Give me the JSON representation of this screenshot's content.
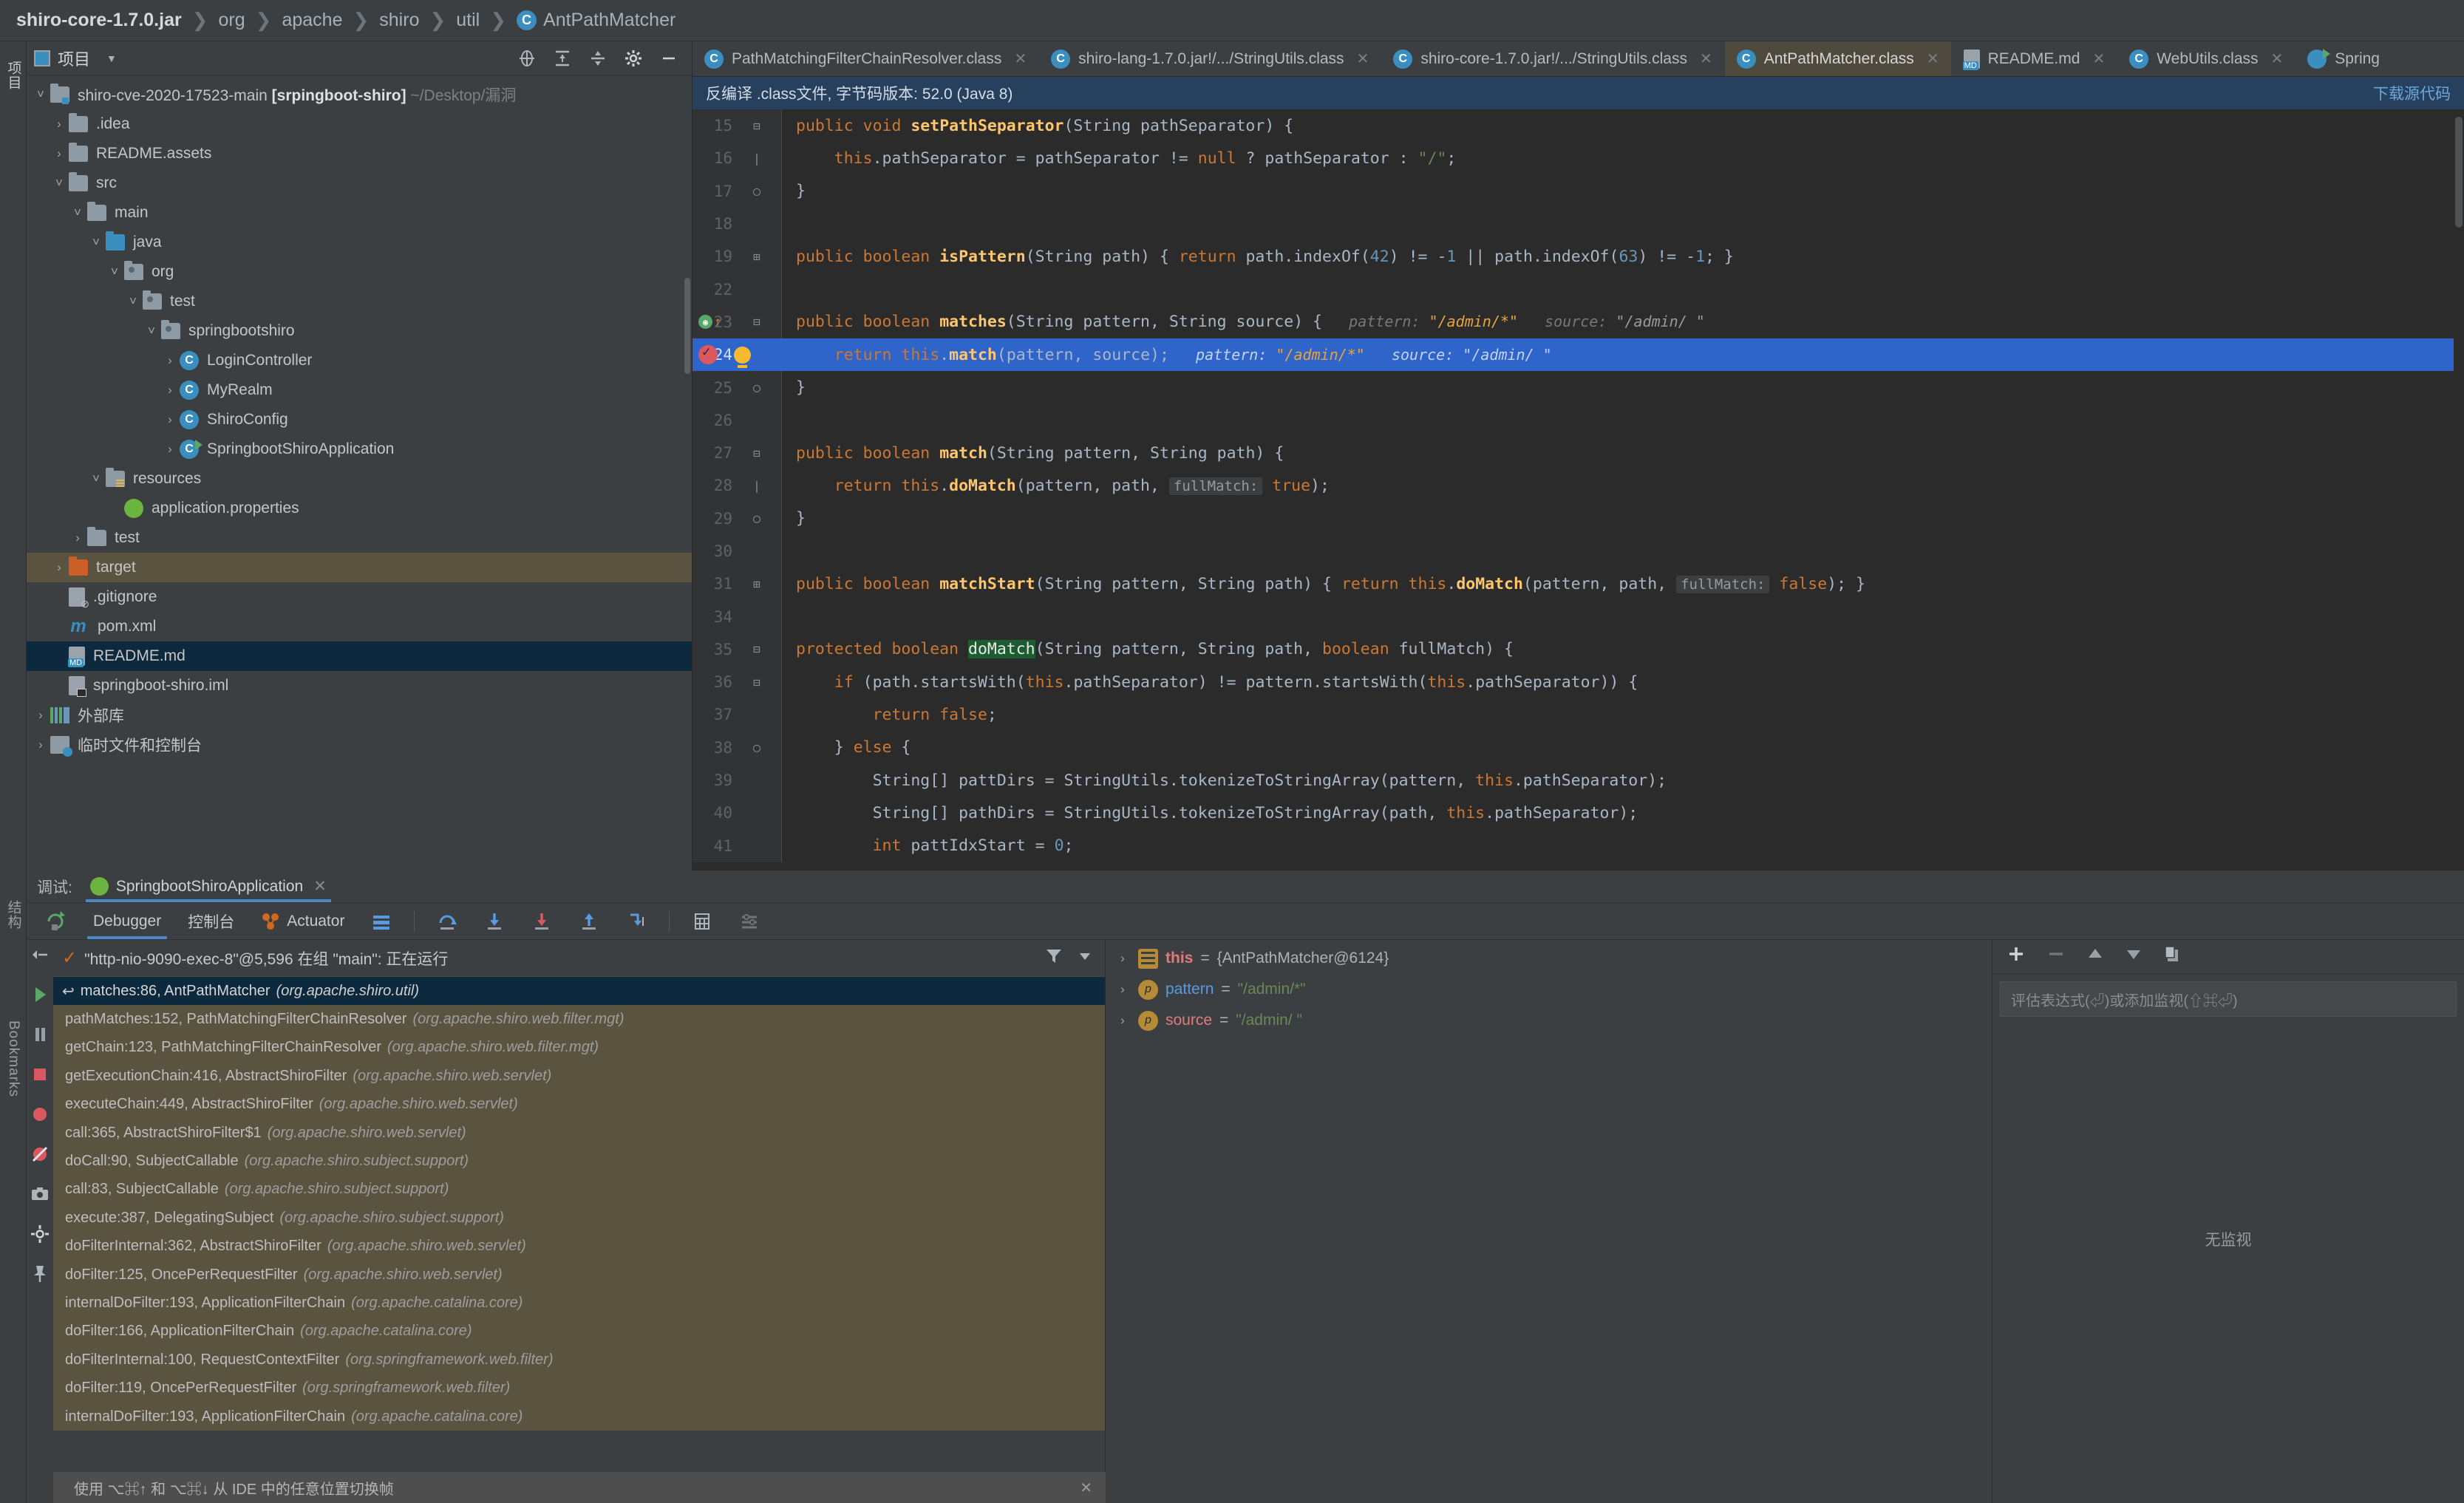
{
  "breadcrumb": {
    "items": [
      {
        "label": "shiro-core-1.7.0.jar",
        "type": "root"
      },
      {
        "label": "org",
        "type": "pkg"
      },
      {
        "label": "apache",
        "type": "pkg"
      },
      {
        "label": "shiro",
        "type": "pkg"
      },
      {
        "label": "util",
        "type": "pkg"
      },
      {
        "label": "AntPathMatcher",
        "type": "class"
      }
    ]
  },
  "left_strip": {
    "project_tab": "项目",
    "structure_tab": "结构",
    "bookmarks_tab": "Bookmarks"
  },
  "project": {
    "title": "项目",
    "tree": [
      {
        "indent": 0,
        "arrow": "v",
        "icon": "folder-module",
        "label": "shiro-cve-2020-17523-main ",
        "bold": "[srpingboot-shiro]",
        "sub": " ~/Desktop/漏洞",
        "state": "normal"
      },
      {
        "indent": 1,
        "arrow": ">",
        "icon": "folder",
        "label": ".idea",
        "state": "normal"
      },
      {
        "indent": 1,
        "arrow": ">",
        "icon": "folder",
        "label": "README.assets",
        "state": "normal"
      },
      {
        "indent": 1,
        "arrow": "v",
        "icon": "folder",
        "label": "src",
        "state": "normal"
      },
      {
        "indent": 2,
        "arrow": "v",
        "icon": "folder",
        "label": "main",
        "state": "normal"
      },
      {
        "indent": 3,
        "arrow": "v",
        "icon": "folder-source",
        "label": "java",
        "state": "normal"
      },
      {
        "indent": 4,
        "arrow": "v",
        "icon": "folder-package",
        "label": "org",
        "state": "normal"
      },
      {
        "indent": 5,
        "arrow": "v",
        "icon": "folder-package",
        "label": "test",
        "state": "normal"
      },
      {
        "indent": 6,
        "arrow": "v",
        "icon": "folder-package",
        "label": "springbootshiro",
        "state": "normal"
      },
      {
        "indent": 7,
        "arrow": ">",
        "icon": "class",
        "label": "LoginController",
        "state": "normal"
      },
      {
        "indent": 7,
        "arrow": ">",
        "icon": "class",
        "label": "MyRealm",
        "state": "normal"
      },
      {
        "indent": 7,
        "arrow": ">",
        "icon": "class",
        "label": "ShiroConfig",
        "state": "normal"
      },
      {
        "indent": 7,
        "arrow": ">",
        "icon": "class-run",
        "label": "SpringbootShiroApplication",
        "state": "normal"
      },
      {
        "indent": 3,
        "arrow": "v",
        "icon": "folder-resources",
        "label": "resources",
        "state": "normal"
      },
      {
        "indent": 4,
        "arrow": "",
        "icon": "spring",
        "label": "application.properties",
        "state": "normal"
      },
      {
        "indent": 2,
        "arrow": ">",
        "icon": "folder",
        "label": "test",
        "state": "normal"
      },
      {
        "indent": 1,
        "arrow": ">",
        "icon": "folder-target",
        "label": "target",
        "state": "target-selected"
      },
      {
        "indent": 1,
        "arrow": "",
        "icon": "file-git",
        "label": ".gitignore",
        "state": "normal"
      },
      {
        "indent": 1,
        "arrow": "",
        "icon": "maven",
        "label": "pom.xml",
        "state": "normal"
      },
      {
        "indent": 1,
        "arrow": "",
        "icon": "file-md",
        "label": "README.md",
        "state": "readme-selected"
      },
      {
        "indent": 1,
        "arrow": "",
        "icon": "file-iml",
        "label": "springboot-shiro.iml",
        "state": "normal"
      },
      {
        "indent": 0,
        "arrow": ">",
        "icon": "libraries",
        "label": "外部库",
        "state": "normal"
      },
      {
        "indent": 0,
        "arrow": ">",
        "icon": "scratches",
        "label": "临时文件和控制台",
        "state": "normal"
      }
    ]
  },
  "editor_tabs": [
    {
      "label": "PathMatchingFilterChainResolver.class",
      "icon": "class",
      "active": false
    },
    {
      "label": "shiro-lang-1.7.0.jar!/.../StringUtils.class",
      "icon": "class",
      "active": false
    },
    {
      "label": "shiro-core-1.7.0.jar!/.../StringUtils.class",
      "icon": "class",
      "active": false
    },
    {
      "label": "AntPathMatcher.class",
      "icon": "class",
      "active": true
    },
    {
      "label": "README.md",
      "icon": "markdown",
      "active": false
    },
    {
      "label": "WebUtils.class",
      "icon": "class",
      "active": false
    },
    {
      "label": "Spring",
      "icon": "spring-run",
      "active": false
    }
  ],
  "notice": {
    "text": "反编译 .class文件, 字节码版本: 52.0 (Java 8)",
    "download_label": "下载源代码"
  },
  "code": {
    "lines": [
      {
        "num": "15",
        "fold": "minus",
        "text": "public void setPathSeparator(String pathSeparator) {"
      },
      {
        "num": "16",
        "fold": "bar",
        "text": "    this.pathSeparator = pathSeparator != null ? pathSeparator : \"/\";"
      },
      {
        "num": "17",
        "fold": "end",
        "text": "}"
      },
      {
        "num": "18",
        "fold": "",
        "text": ""
      },
      {
        "num": "19",
        "fold": "plus",
        "text": "public boolean isPattern(String path) { return path.indexOf(42) != -1 || path.indexOf(63) != -1; }"
      },
      {
        "num": "22",
        "fold": "",
        "text": ""
      },
      {
        "num": "23",
        "fold": "minus",
        "text": "public boolean matches(String pattern, String source) {",
        "hints": [
          {
            "name": "pattern:",
            "value": "\"/admin/*\""
          },
          {
            "name": "source:",
            "value": "\"/admin/ \""
          }
        ]
      },
      {
        "num": "24",
        "fold": "",
        "text": "    return this.match(pattern, source);",
        "hints": [
          {
            "name": "pattern:",
            "value": "\"/admin/*\""
          },
          {
            "name": "source:",
            "value": "\"/admin/ \""
          }
        ],
        "highlighted": true
      },
      {
        "num": "25",
        "fold": "end",
        "text": "}"
      },
      {
        "num": "26",
        "fold": "",
        "text": ""
      },
      {
        "num": "27",
        "fold": "minus",
        "text": "public boolean match(String pattern, String path) {"
      },
      {
        "num": "28",
        "fold": "bar",
        "text": "    return this.doMatch(pattern, path, fullMatch: true);"
      },
      {
        "num": "29",
        "fold": "end",
        "text": "}"
      },
      {
        "num": "30",
        "fold": "",
        "text": ""
      },
      {
        "num": "31",
        "fold": "plus",
        "text": "public boolean matchStart(String pattern, String path) { return this.doMatch(pattern, path, fullMatch: false); }"
      },
      {
        "num": "34",
        "fold": "",
        "text": ""
      },
      {
        "num": "35",
        "fold": "minus",
        "text": "protected boolean doMatch(String pattern, String path, boolean fullMatch) {"
      },
      {
        "num": "36",
        "fold": "minus",
        "text": "    if (path.startsWith(this.pathSeparator) != pattern.startsWith(this.pathSeparator)) {"
      },
      {
        "num": "37",
        "fold": "",
        "text": "        return false;"
      },
      {
        "num": "38",
        "fold": "end",
        "text": "    } else {"
      },
      {
        "num": "39",
        "fold": "",
        "text": "        String[] pattDirs = StringUtils.tokenizeToStringArray(pattern, this.pathSeparator);"
      },
      {
        "num": "40",
        "fold": "",
        "text": "        String[] pathDirs = StringUtils.tokenizeToStringArray(path, this.pathSeparator);"
      },
      {
        "num": "41",
        "fold": "",
        "text": "        int pattIdxStart = 0;"
      }
    ]
  },
  "debug": {
    "header_label": "调试:",
    "session_name": "SpringbootShiroApplication",
    "tabs": [
      {
        "label": "Debugger",
        "active": true
      },
      {
        "label": "控制台",
        "active": false
      },
      {
        "label": "Actuator",
        "active": false
      }
    ],
    "thread": "\"http-nio-9090-exec-8\"@5,596 在组 \"main\": 正在运行",
    "frames": [
      {
        "label": "matches:86, AntPathMatcher",
        "pkg": "(org.apache.shiro.util)",
        "current": true
      },
      {
        "label": "pathMatches:152, PathMatchingFilterChainResolver",
        "pkg": "(org.apache.shiro.web.filter.mgt)",
        "current": false
      },
      {
        "label": "getChain:123, PathMatchingFilterChainResolver",
        "pkg": "(org.apache.shiro.web.filter.mgt)",
        "current": false
      },
      {
        "label": "getExecutionChain:416, AbstractShiroFilter",
        "pkg": "(org.apache.shiro.web.servlet)",
        "current": false
      },
      {
        "label": "executeChain:449, AbstractShiroFilter",
        "pkg": "(org.apache.shiro.web.servlet)",
        "current": false
      },
      {
        "label": "call:365, AbstractShiroFilter$1",
        "pkg": "(org.apache.shiro.web.servlet)",
        "current": false
      },
      {
        "label": "doCall:90, SubjectCallable",
        "pkg": "(org.apache.shiro.subject.support)",
        "current": false
      },
      {
        "label": "call:83, SubjectCallable",
        "pkg": "(org.apache.shiro.subject.support)",
        "current": false
      },
      {
        "label": "execute:387, DelegatingSubject",
        "pkg": "(org.apache.shiro.subject.support)",
        "current": false
      },
      {
        "label": "doFilterInternal:362, AbstractShiroFilter",
        "pkg": "(org.apache.shiro.web.servlet)",
        "current": false
      },
      {
        "label": "doFilter:125, OncePerRequestFilter",
        "pkg": "(org.apache.shiro.web.servlet)",
        "current": false
      },
      {
        "label": "internalDoFilter:193, ApplicationFilterChain",
        "pkg": "(org.apache.catalina.core)",
        "current": false
      },
      {
        "label": "doFilter:166, ApplicationFilterChain",
        "pkg": "(org.apache.catalina.core)",
        "current": false
      },
      {
        "label": "doFilterInternal:100, RequestContextFilter",
        "pkg": "(org.springframework.web.filter)",
        "current": false
      },
      {
        "label": "doFilter:119, OncePerRequestFilter",
        "pkg": "(org.springframework.web.filter)",
        "current": false
      },
      {
        "label": "internalDoFilter:193, ApplicationFilterChain",
        "pkg": "(org.apache.catalina.core)",
        "current": false
      }
    ],
    "hint": "使用 ⌥⌘↑ 和 ⌥⌘↓ 从 IDE 中的任意位置切换帧",
    "variables": [
      {
        "name": "this",
        "value": "{AntPathMatcher@6124}",
        "kind": "object"
      },
      {
        "name": "pattern",
        "value": "\"/admin/*\"",
        "kind": "param"
      },
      {
        "name": "source",
        "value": "\"/admin/ \"",
        "kind": "param"
      }
    ],
    "watch_placeholder": "评估表达式(⏎)或添加监视(⇧⌘⏎)",
    "watch_empty": "无监视"
  }
}
